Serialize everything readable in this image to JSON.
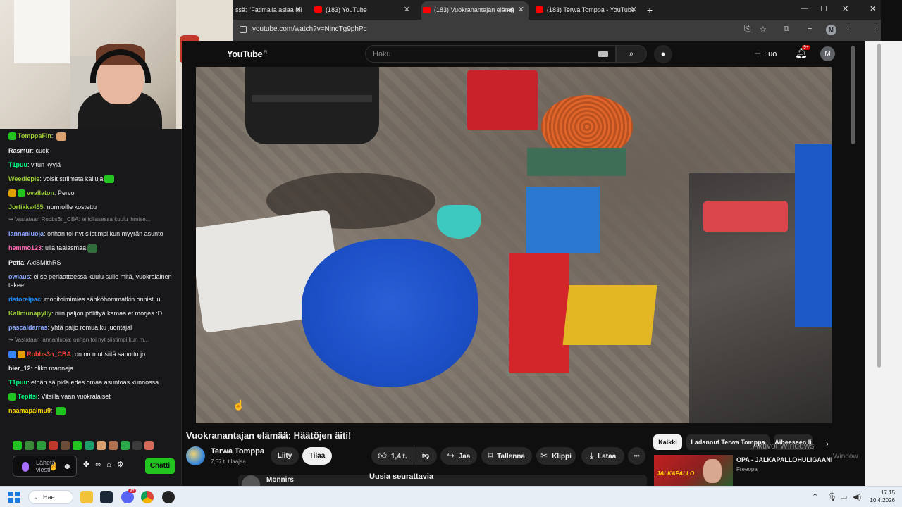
{
  "browser": {
    "tabs": [
      {
        "label": "ssä: \"Fatimalla asiaa mi",
        "active": false
      },
      {
        "label": "(183) YouTube",
        "active": false
      },
      {
        "label": "(183) Vuokranantajan elämä",
        "active": true
      },
      {
        "label": "(183) Terwa Tomppa - YouTube",
        "active": false
      }
    ],
    "url": "youtube.com/watch?v=NincTg9phPc",
    "profile_initial": "M",
    "new_tab": "+",
    "win_min": "—",
    "win_max": "☐",
    "win_close": "✕"
  },
  "youtube": {
    "logo": "YouTube",
    "region": "FI",
    "search_placeholder": "Haku",
    "create_label": "Luo",
    "notifications": "9+",
    "avatar_initial": "M",
    "video_title": "Vuokranantajan elämää: Häätöjen äiti!",
    "channel_name": "Terwa Tomppa",
    "subscribers": "7,57 t. tilaajaa",
    "join_label": "Liity",
    "subscribe_label": "Tilaa",
    "like_count": "1,4 t.",
    "share_label": "Jaa",
    "save_label": "Tallenna",
    "clip_label": "Klippi",
    "download_label": "Lataa",
    "more_label": "•••",
    "chips": [
      "Kaikki",
      "Ladannut Terwa Tomppa",
      "Aiheeseen li"
    ],
    "rec_thumb_text": "JALKAPALLO",
    "rec_title": "OPA - JALKAPALLOHULIGAANI",
    "rec_channel": "Freeopa",
    "comment_user": "Monnirs",
    "new_followers": "Uusia seurattavia",
    "activate_windows": "Aktivoi Windows",
    "activate_windows_sub": "Window"
  },
  "chat": {
    "messages": [
      {
        "user": "TomppaFin",
        "text": "",
        "color": "#9acd32",
        "badges": [
          "#22c51f"
        ],
        "emote": "#d9a070"
      },
      {
        "user": "Rasmur",
        "text": "cuck",
        "color": "#f0f0f0"
      },
      {
        "user": "T1puu",
        "text": "vitun kyylä",
        "color": "#00ff7f"
      },
      {
        "user": "Weediepie",
        "text": "voisit striimata kalluja",
        "color": "#9acd32",
        "emote": "#22c51f"
      },
      {
        "user": "vvallaton",
        "text": "Pervo",
        "color": "#9acd32",
        "badges": [
          "#e0a000",
          "#22c51f"
        ]
      },
      {
        "user": "Jortikka455",
        "text": "normoille kostettu",
        "color": "#9acd32"
      },
      {
        "user": "",
        "text": "↪ Vastataan Robbs3n_CBA: ei tollasessa kuulu ihmise...",
        "system": true
      },
      {
        "user": "lannanluoja",
        "text": "onhan toi nyt siistimpi kun myyrän asunto",
        "color": "#8aa8ff"
      },
      {
        "user": "hemmo123",
        "text": "ulla taalasmaa",
        "color": "#ff69b4",
        "emote": "#2f6e3a"
      },
      {
        "user": "Peffa",
        "text": "AxlSMithRS",
        "color": "#f0f0f0"
      },
      {
        "user": "owlaus",
        "text": "ei se periaatteessa kuulu sulle mitä, vuokralainen tekee",
        "color": "#8aa8ff"
      },
      {
        "user": "ristoreipac",
        "text": "monitoimimies sähköhommatkin onnistuu",
        "color": "#1e90ff"
      },
      {
        "user": "Kallmunapylly",
        "text": "niin paljon pölittyä kamaa et morjes :D",
        "color": "#9acd32"
      },
      {
        "user": "pascaldarras",
        "text": "yhtä paljo romua ku juontajal",
        "color": "#8aa8ff"
      },
      {
        "user": "",
        "text": "↪ Vastataan lannanluoja: onhan toi nyt siistimpi kun m...",
        "system": true
      },
      {
        "user": "Robbs3n_CBA",
        "text": "on on mut siitä sanottu jo",
        "color": "#ff4040",
        "badges": [
          "#3b82f6",
          "#e0a000"
        ]
      },
      {
        "user": "bier_12",
        "text": "oliko manneja",
        "color": "#f0f0f0"
      },
      {
        "user": "T1puu",
        "text": "ethän sä pidä edes omaa asuntoas kunnossa",
        "color": "#00ff7f"
      },
      {
        "user": "Tepitsi",
        "text": "Vitsillä vaan vuokralaiset",
        "color": "#00ff7f",
        "badges": [
          "#22c51f"
        ]
      },
      {
        "user": "naamapalmu9",
        "text": "",
        "color": "#ffd700",
        "emote": "#22c51f"
      }
    ],
    "input_placeholder": "Lähetä viesti",
    "send_label": "Chatti",
    "points": "∞"
  },
  "taskbar": {
    "search_label": "Hae",
    "discord_count": "9+",
    "time": "17.15",
    "date": "10.4.2026"
  }
}
